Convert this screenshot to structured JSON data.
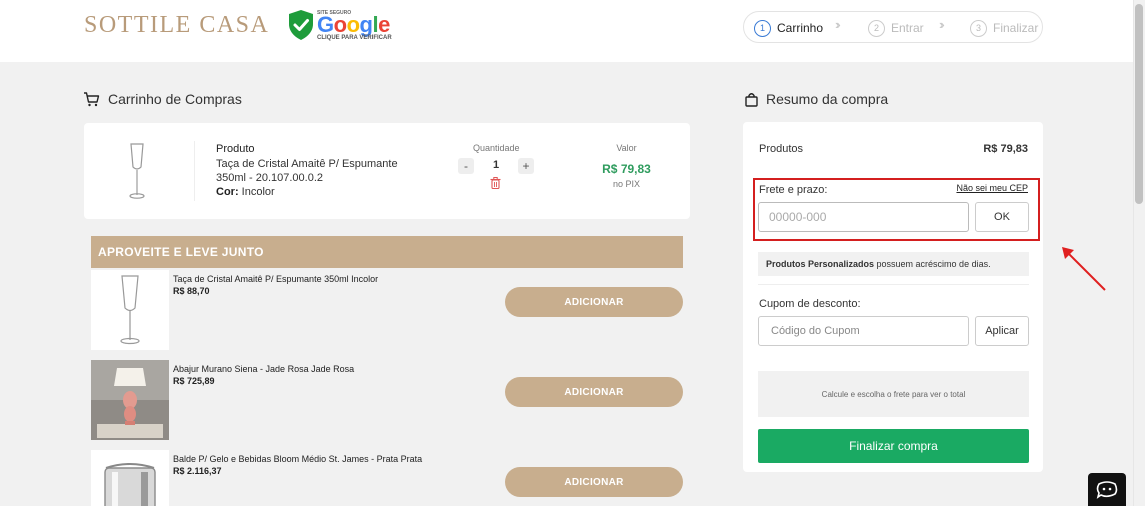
{
  "header": {
    "logo": "SOTTILE CASA",
    "google_badge": {
      "small": "SITE SEGURO",
      "word": "Google",
      "sub": "CLIQUE PARA VERIFICAR"
    },
    "steps": [
      {
        "num": "1",
        "label": "Carrinho"
      },
      {
        "num": "2",
        "label": "Entrar"
      },
      {
        "num": "3",
        "label": "Finalizar"
      }
    ]
  },
  "cart": {
    "title": "Carrinho de Compras",
    "item": {
      "heading": "Produto",
      "name": "Taça de Cristal Amaitê P/ Espumante 350ml - 20.107.00.0.2",
      "variant_label": "Cor:",
      "variant_value": "Incolor",
      "qty_label": "Quantidade",
      "qty_minus": "-",
      "qty": "1",
      "qty_plus": "+",
      "value_label": "Valor",
      "price": "R$ 79,83",
      "price_note": "no PIX"
    }
  },
  "upsell": {
    "title": "APROVEITE E LEVE JUNTO",
    "button_label": "ADICIONAR",
    "items": [
      {
        "name": "Taça de Cristal Amaitê P/ Espumante 350ml Incolor",
        "price": "R$ 88,70"
      },
      {
        "name": "Abajur Murano Siena - Jade Rosa Jade Rosa",
        "price": "R$ 725,89"
      },
      {
        "name": "Balde P/ Gelo e Bebidas Bloom Médio St. James - Prata Prata",
        "price": "R$ 2.116,37"
      }
    ]
  },
  "summary": {
    "title": "Resumo da compra",
    "products_label": "Produtos",
    "products_value": "R$ 79,83",
    "shipping_label": "Frete e prazo:",
    "cep_link": "Não sei meu CEP",
    "cep_placeholder": "00000-000",
    "ok_label": "OK",
    "notice_bold": "Produtos Personalizados",
    "notice_rest": " possuem acréscimo de dias.",
    "coupon_label": "Cupom de desconto:",
    "coupon_placeholder": "Código do Cupom",
    "coupon_button": "Aplicar",
    "calc_note": "Calcule e escolha o frete para ver o total",
    "finish_label": "Finalizar compra"
  },
  "colors": {
    "brand_tan": "#c8ae8e",
    "price_green": "#2f9c5e",
    "finish_green": "#1aaa63",
    "highlight_red": "#d41f1f",
    "active_step": "#3a7bd5"
  },
  "icons": [
    "cart-icon",
    "bag-icon",
    "shield-check-icon",
    "trash-icon",
    "chevron-double-right-icon",
    "chat-icon",
    "annotation-arrow"
  ]
}
